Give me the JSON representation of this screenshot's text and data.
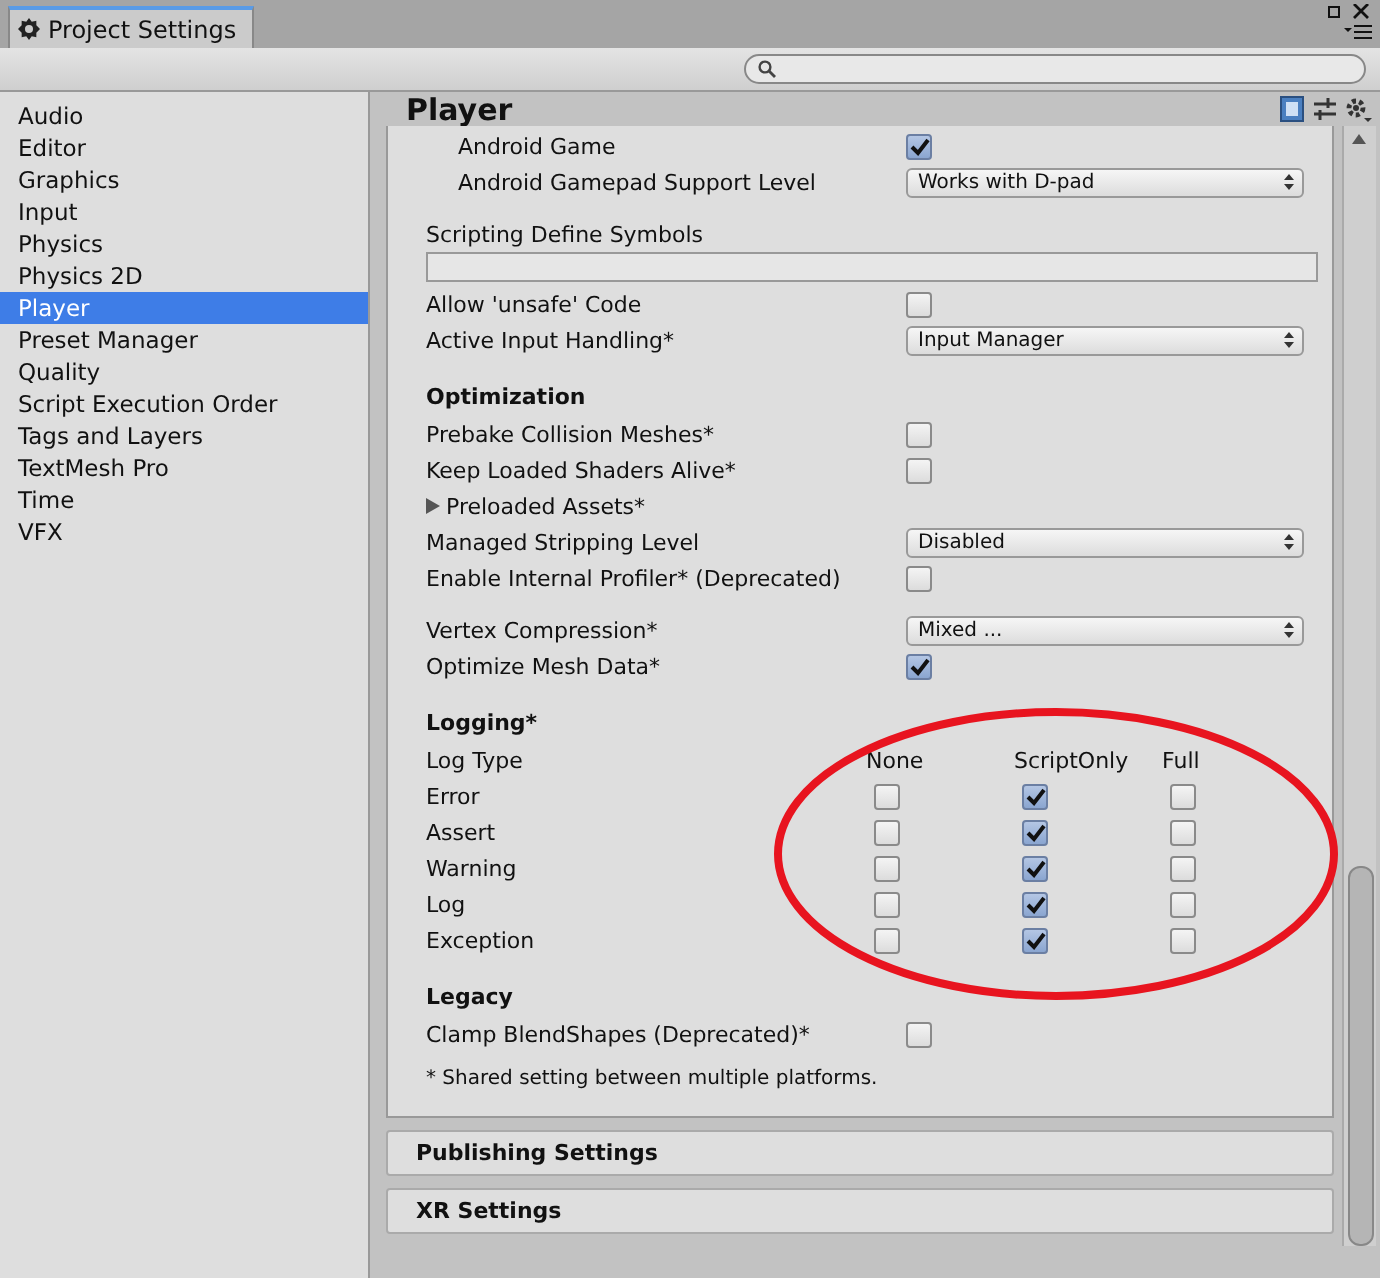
{
  "window": {
    "tab_title": "Project Settings"
  },
  "sidebar": {
    "items": [
      {
        "label": "Audio",
        "selected": false
      },
      {
        "label": "Editor",
        "selected": false
      },
      {
        "label": "Graphics",
        "selected": false
      },
      {
        "label": "Input",
        "selected": false
      },
      {
        "label": "Physics",
        "selected": false
      },
      {
        "label": "Physics 2D",
        "selected": false
      },
      {
        "label": "Player",
        "selected": true
      },
      {
        "label": "Preset Manager",
        "selected": false
      },
      {
        "label": "Quality",
        "selected": false
      },
      {
        "label": "Script Execution Order",
        "selected": false
      },
      {
        "label": "Tags and Layers",
        "selected": false
      },
      {
        "label": "TextMesh Pro",
        "selected": false
      },
      {
        "label": "Time",
        "selected": false
      },
      {
        "label": "VFX",
        "selected": false
      }
    ]
  },
  "inspector": {
    "title": "Player",
    "groups": [
      {
        "indented": true,
        "rows": [
          {
            "kind": "checkbox",
            "label": "Android Game",
            "checked": true
          },
          {
            "kind": "dropdown",
            "label": "Android Gamepad Support Level",
            "value": "Works with D-pad"
          }
        ]
      },
      {
        "rows": [
          {
            "kind": "text_field",
            "label": "Scripting Define Symbols"
          },
          {
            "kind": "checkbox",
            "label": "Allow 'unsafe' Code",
            "checked": false
          },
          {
            "kind": "dropdown",
            "label": "Active Input Handling*",
            "value": "Input Manager"
          }
        ]
      },
      {
        "header": "Optimization",
        "rows": [
          {
            "kind": "checkbox",
            "label": "Prebake Collision Meshes*",
            "checked": false
          },
          {
            "kind": "checkbox",
            "label": "Keep Loaded Shaders Alive*",
            "checked": false
          },
          {
            "kind": "foldout",
            "label": "Preloaded Assets*",
            "expanded": false
          },
          {
            "kind": "dropdown",
            "label": "Managed Stripping Level",
            "value": "Disabled"
          },
          {
            "kind": "checkbox",
            "label": "Enable Internal Profiler* (Deprecated)",
            "checked": false
          }
        ]
      },
      {
        "rows": [
          {
            "kind": "dropdown",
            "label": "Vertex Compression*",
            "value": "Mixed ..."
          },
          {
            "kind": "checkbox",
            "label": "Optimize Mesh Data*",
            "checked": true
          }
        ]
      },
      {
        "header": "Logging*",
        "rows": [
          {
            "kind": "matrix",
            "label": "Log Type",
            "columns": [
              "None",
              "ScriptOnly",
              "Full"
            ],
            "rows": [
              {
                "label": "Error",
                "checked": [
                  false,
                  true,
                  false
                ]
              },
              {
                "label": "Assert",
                "checked": [
                  false,
                  true,
                  false
                ]
              },
              {
                "label": "Warning",
                "checked": [
                  false,
                  true,
                  false
                ]
              },
              {
                "label": "Log",
                "checked": [
                  false,
                  true,
                  false
                ]
              },
              {
                "label": "Exception",
                "checked": [
                  false,
                  true,
                  false
                ]
              }
            ]
          }
        ]
      },
      {
        "header": "Legacy",
        "rows": [
          {
            "kind": "checkbox",
            "label": "Clamp BlendShapes (Deprecated)*",
            "checked": false
          }
        ]
      }
    ],
    "note": "* Shared setting between multiple platforms.",
    "sections": [
      {
        "label": "Publishing Settings",
        "expanded": false
      },
      {
        "label": "XR Settings",
        "expanded": false
      }
    ]
  }
}
